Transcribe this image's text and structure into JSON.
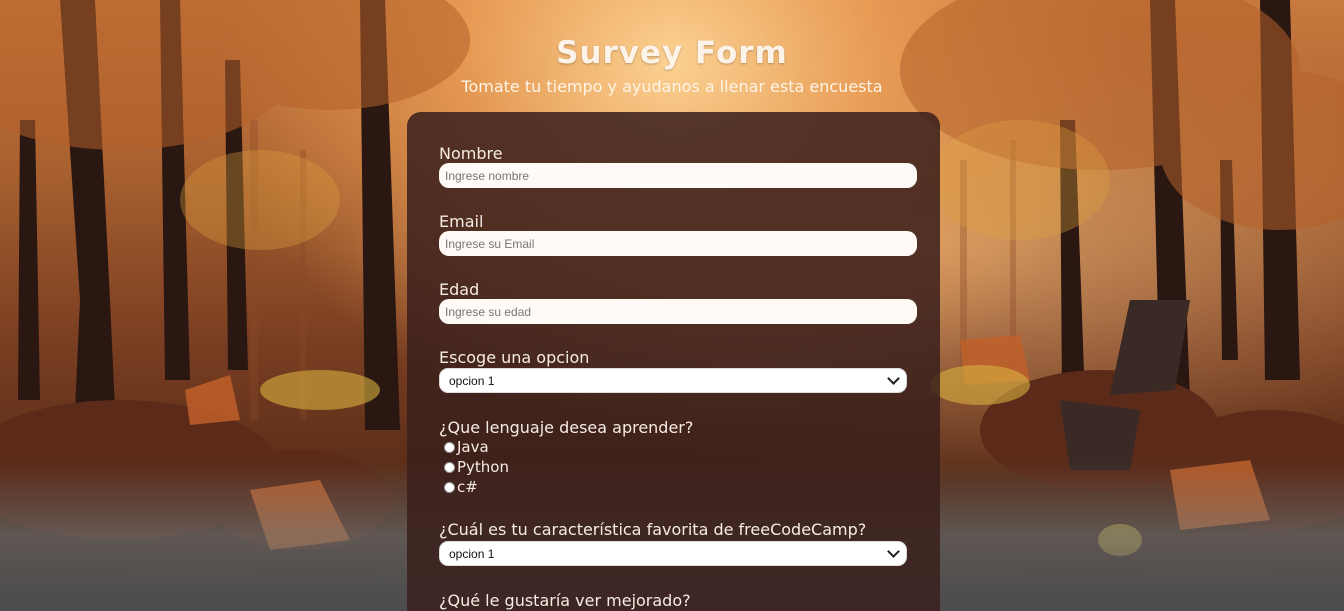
{
  "header": {
    "title": "Survey Form",
    "subtitle": "Tomate tu tiempo y ayudanos a llenar esta encuesta"
  },
  "form": {
    "name": {
      "label": "Nombre",
      "placeholder": "Ingrese nombre",
      "value": ""
    },
    "email": {
      "label": "Email",
      "placeholder": "Ingrese su Email",
      "value": ""
    },
    "age": {
      "label": "Edad",
      "placeholder": "Ingrese su edad",
      "value": ""
    },
    "option_select": {
      "label": "Escoge una opcion",
      "selected": "opcion 1"
    },
    "language": {
      "label": "¿Que lenguaje desea aprender?",
      "options": [
        "Java",
        "Python",
        "c#"
      ]
    },
    "favorite_feature": {
      "label": "¿Cuál es tu característica favorita de freeCodeCamp?",
      "selected": "opcion 1"
    },
    "improve": {
      "label": "¿Qué le gustaría ver mejorado?"
    }
  },
  "colors": {
    "card_bg": "#3a201c",
    "text": "#f6ece2",
    "input_bg": "#fffaf6"
  }
}
